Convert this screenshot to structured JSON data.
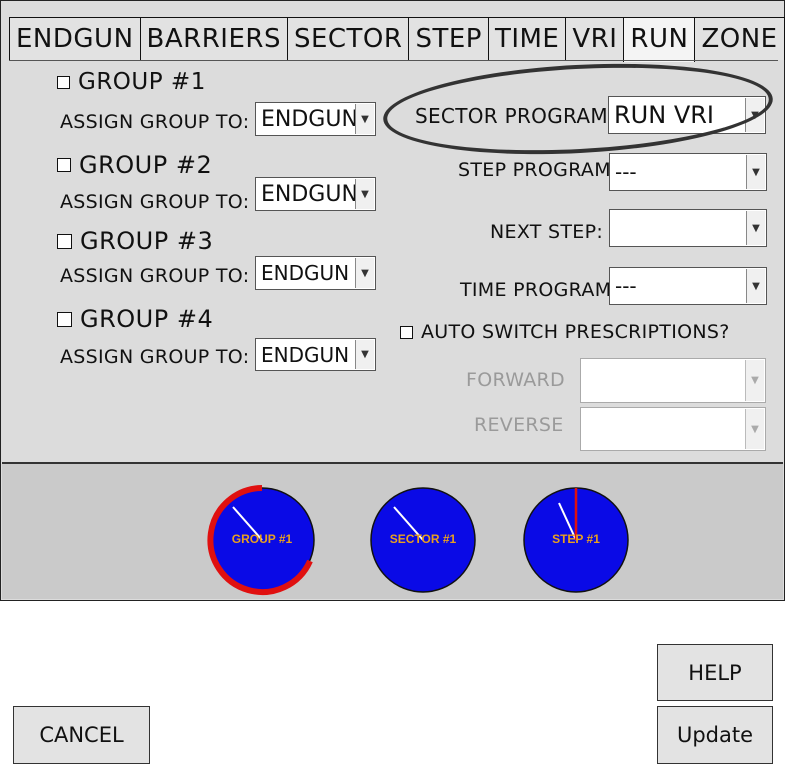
{
  "tabs": [
    "ENDGUN",
    "BARRIERS",
    "SECTOR",
    "STEP",
    "TIME",
    "VRI",
    "RUN",
    "ZONE"
  ],
  "active_tab": "RUN",
  "groups": [
    {
      "label": "GROUP #1",
      "assign_label": "ASSIGN GROUP TO:",
      "assign_value": "ENDGUN"
    },
    {
      "label": "GROUP #2",
      "assign_label": "ASSIGN GROUP TO:",
      "assign_value": "ENDGUN"
    },
    {
      "label": "GROUP #3",
      "assign_label": "ASSIGN GROUP TO:",
      "assign_value": "ENDGUN"
    },
    {
      "label": "GROUP #4",
      "assign_label": "ASSIGN GROUP TO:",
      "assign_value": "ENDGUN"
    }
  ],
  "programs": {
    "sector_label": "SECTOR PROGRAM:",
    "sector_value": "RUN VRI",
    "step_label": "STEP PROGRAM:",
    "step_value": "---",
    "next_step_label": "NEXT STEP:",
    "next_step_value": "",
    "time_label": "TIME PROGRAM:",
    "time_value": "---"
  },
  "auto_switch": {
    "label": "AUTO SWITCH PRESCRIPTIONS?",
    "forward_label": "FORWARD",
    "forward_value": "",
    "reverse_label": "REVERSE",
    "reverse_value": ""
  },
  "bottom": {
    "cancel_label": "CANCEL",
    "help_label": "HELP",
    "update_label": "Update",
    "gauges": [
      "GROUP #1",
      "SECTOR #1",
      "STEP #1"
    ]
  },
  "colors": {
    "gauge_fill": "#0a0ae6",
    "gauge_arc": "#e01010",
    "gauge_text": "#e8a020"
  }
}
